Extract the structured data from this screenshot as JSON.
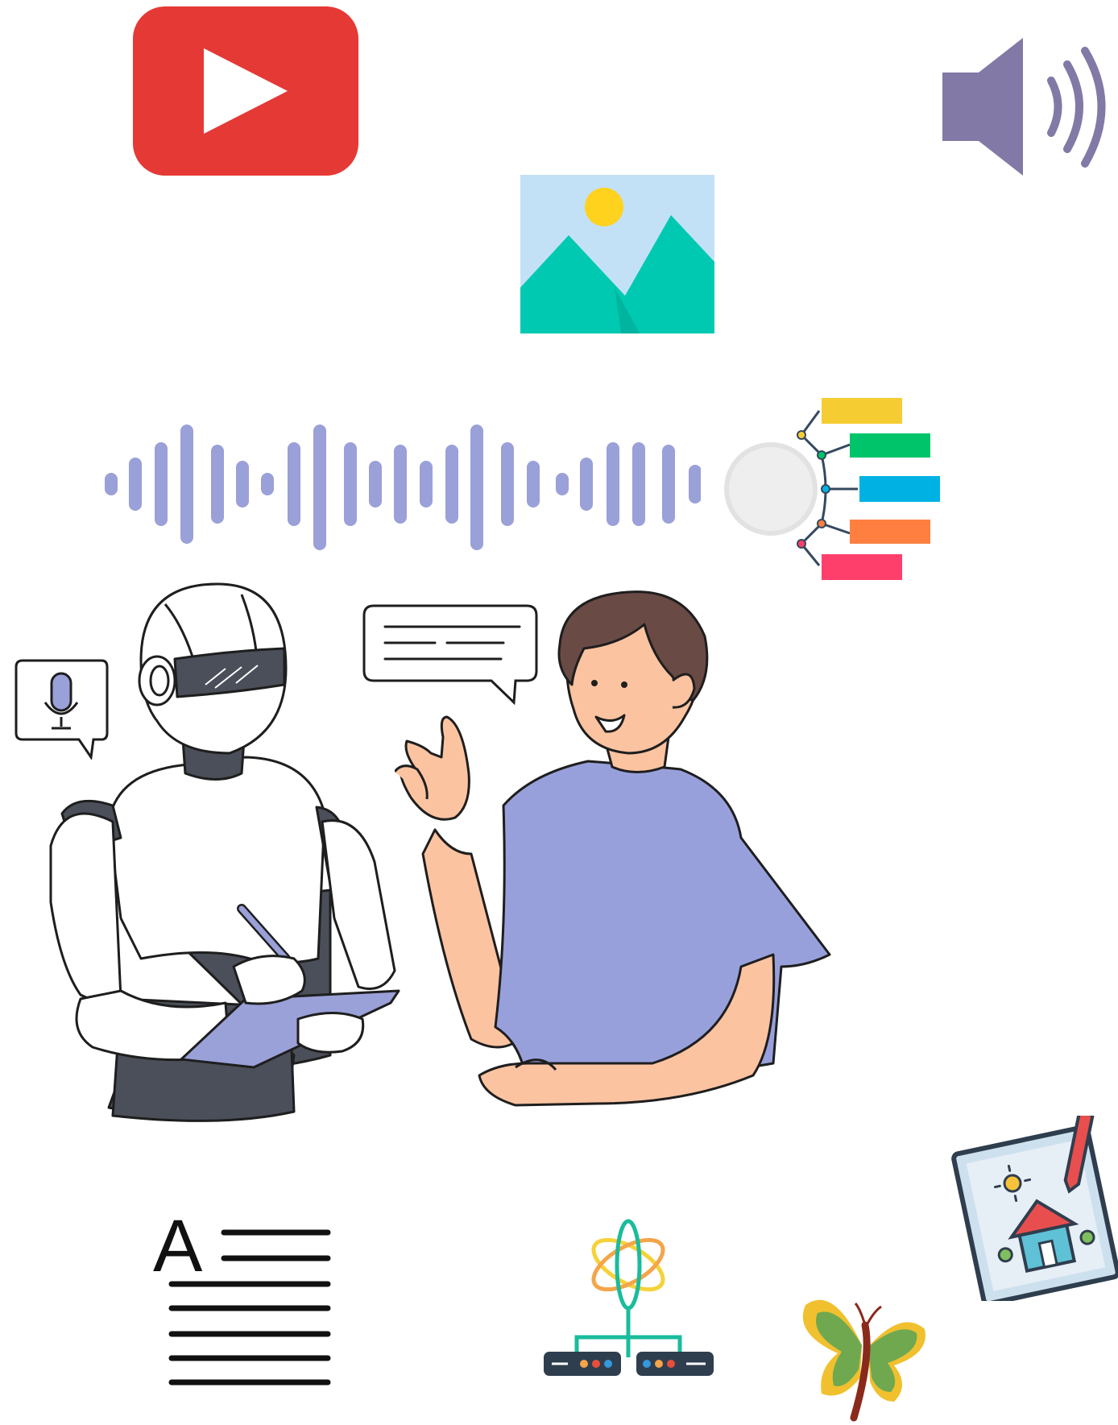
{
  "canvas": {
    "background": "#ffffff"
  },
  "icons": {
    "video": {
      "name": "video-play-icon",
      "color": "#e53935",
      "glyph": "#ffffff"
    },
    "speaker": {
      "name": "speaker-volume-icon",
      "color": "#8279a6"
    },
    "image": {
      "name": "image-landscape-icon",
      "sky": "#c3e1f6",
      "sun": "#ffd21e",
      "mountain": "#00c9b1"
    },
    "waveform": {
      "name": "audio-waveform-icon",
      "color": "#9aa0d8"
    },
    "mindmap": {
      "name": "mind-map-icon",
      "branch_colors": [
        "#f5cd33",
        "#00c46a",
        "#00b2e3",
        "#ff7f40",
        "#ff3f6b"
      ]
    },
    "microphone_bubble": {
      "name": "microphone-speech-bubble-icon",
      "color": "#9aa0d8"
    },
    "text_bubble": {
      "name": "text-speech-bubble-icon"
    },
    "robot": {
      "name": "robot-with-tablet",
      "body": "#ffffff",
      "dark": "#4b4f59",
      "tablet": "#9aa0d8"
    },
    "person": {
      "name": "person-gesturing",
      "shirt": "#98a0dc",
      "skin": "#fcc3a1",
      "hair": "#6a4a45"
    },
    "text_document": {
      "name": "text-document-icon",
      "letter": "A"
    },
    "network": {
      "name": "atom-network-icon"
    },
    "drawing": {
      "name": "drawing-pencil-icon"
    },
    "butterfly": {
      "name": "butterfly-icon",
      "wing": "#6fa84f",
      "accent": "#f0c02e",
      "body": "#8a2a1b"
    }
  }
}
